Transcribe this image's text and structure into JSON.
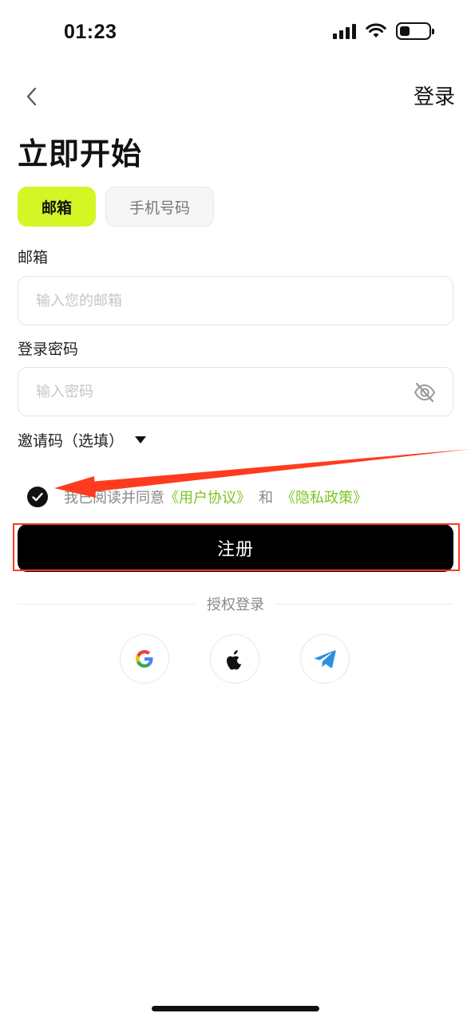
{
  "status_bar": {
    "time": "01:23"
  },
  "nav": {
    "login_label": "登录"
  },
  "page": {
    "title": "立即开始"
  },
  "tabs": [
    {
      "label": "邮箱",
      "active": true
    },
    {
      "label": "手机号码",
      "active": false
    }
  ],
  "form": {
    "email_label": "邮箱",
    "email_placeholder": "输入您的邮箱",
    "email_value": "",
    "password_label": "登录密码",
    "password_placeholder": "输入密码",
    "password_value": "",
    "invite_label": "邀请码（选填）"
  },
  "agreement": {
    "checked": true,
    "prefix": "我已阅读并同意",
    "user_agreement": "《用户协议》",
    "and": "和",
    "privacy_policy": "《隐私政策》"
  },
  "register_label": "注册",
  "auth": {
    "divider_label": "授权登录",
    "providers": [
      "google-icon",
      "apple-icon",
      "telegram-icon"
    ]
  },
  "colors": {
    "accent": "#d3f625",
    "link": "#7cc520",
    "annotation": "#ff3b1f"
  }
}
